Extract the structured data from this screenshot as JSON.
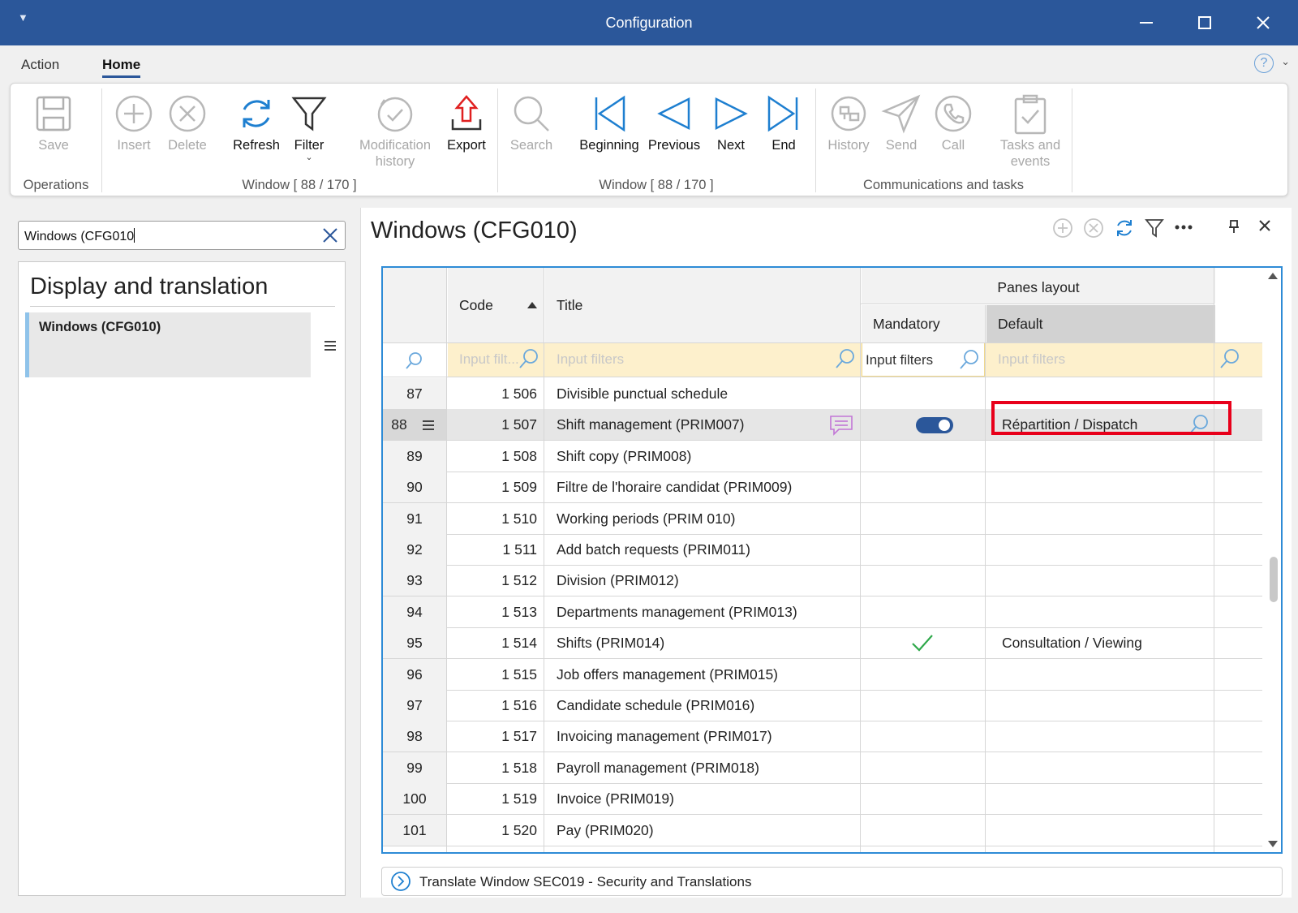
{
  "window": {
    "title": "Configuration"
  },
  "menu": {
    "tabs": [
      {
        "label": "Action"
      },
      {
        "label": "Home"
      }
    ],
    "help": "?"
  },
  "ribbon": {
    "buttons": {
      "save": "Save",
      "insert": "Insert",
      "delete": "Delete",
      "refresh": "Refresh",
      "filter": "Filter",
      "modification_1": "Modification",
      "modification_2": "history",
      "export": "Export",
      "search": "Search",
      "beginning": "Beginning",
      "previous": "Previous",
      "next": "Next",
      "end": "End",
      "history": "History",
      "send": "Send",
      "call": "Call",
      "tasks_1": "Tasks and",
      "tasks_2": "events"
    },
    "groups": {
      "operations": "Operations",
      "window1": "Window [ 88 / 170 ]",
      "window2": "Window [ 88 / 170 ]",
      "communications": "Communications and tasks"
    }
  },
  "left": {
    "search_value": "Windows (CFG010",
    "heading": "Display and translation",
    "nav_item": "Windows (CFG010)"
  },
  "main": {
    "title": "Windows (CFG010)"
  },
  "grid": {
    "headers": {
      "code": "Code",
      "title": "Title",
      "panes": "Panes layout",
      "mandatory": "Mandatory",
      "default": "Default"
    },
    "filters": {
      "code": "Input filt...",
      "title": "Input filters",
      "mandatory": "Input filters",
      "default": "Input filters"
    },
    "rows": [
      {
        "n": "87",
        "code": "1 506",
        "title": "Divisible punctual schedule",
        "mandatory": "",
        "default": ""
      },
      {
        "n": "88",
        "code": "1 507",
        "title": "Shift management (PRIM007)",
        "mandatory": "toggle",
        "default": "Répartition / Dispatch"
      },
      {
        "n": "89",
        "code": "1 508",
        "title": "Shift copy (PRIM008)",
        "mandatory": "",
        "default": ""
      },
      {
        "n": "90",
        "code": "1 509",
        "title": "Filtre de l'horaire candidat (PRIM009)",
        "mandatory": "",
        "default": ""
      },
      {
        "n": "91",
        "code": "1 510",
        "title": "Working periods (PRIM 010)",
        "mandatory": "",
        "default": ""
      },
      {
        "n": "92",
        "code": "1 511",
        "title": "Add batch requests (PRIM011)",
        "mandatory": "",
        "default": ""
      },
      {
        "n": "93",
        "code": "1 512",
        "title": "Division (PRIM012)",
        "mandatory": "",
        "default": ""
      },
      {
        "n": "94",
        "code": "1 513",
        "title": "Departments management (PRIM013)",
        "mandatory": "",
        "default": ""
      },
      {
        "n": "95",
        "code": "1 514",
        "title": "Shifts (PRIM014)",
        "mandatory": "check",
        "default": "Consultation / Viewing"
      },
      {
        "n": "96",
        "code": "1 515",
        "title": "Job offers management (PRIM015)",
        "mandatory": "",
        "default": ""
      },
      {
        "n": "97",
        "code": "1 516",
        "title": "Candidate schedule (PRIM016)",
        "mandatory": "",
        "default": ""
      },
      {
        "n": "98",
        "code": "1 517",
        "title": "Invoicing management (PRIM017)",
        "mandatory": "",
        "default": ""
      },
      {
        "n": "99",
        "code": "1 518",
        "title": "Payroll management (PRIM018)",
        "mandatory": "",
        "default": ""
      },
      {
        "n": "100",
        "code": "1 519",
        "title": "Invoice (PRIM019)",
        "mandatory": "",
        "default": ""
      },
      {
        "n": "101",
        "code": "1 520",
        "title": "Pay (PRIM020)",
        "mandatory": "",
        "default": ""
      }
    ],
    "selected_row": "88"
  },
  "footer": {
    "label": "Translate Window SEC019 - Security and Translations"
  },
  "colors": {
    "accent": "#2b579a",
    "highlight": "#e8001b",
    "filter_bg": "#fdf0cc",
    "icon_blue": "#1e7fd0"
  }
}
